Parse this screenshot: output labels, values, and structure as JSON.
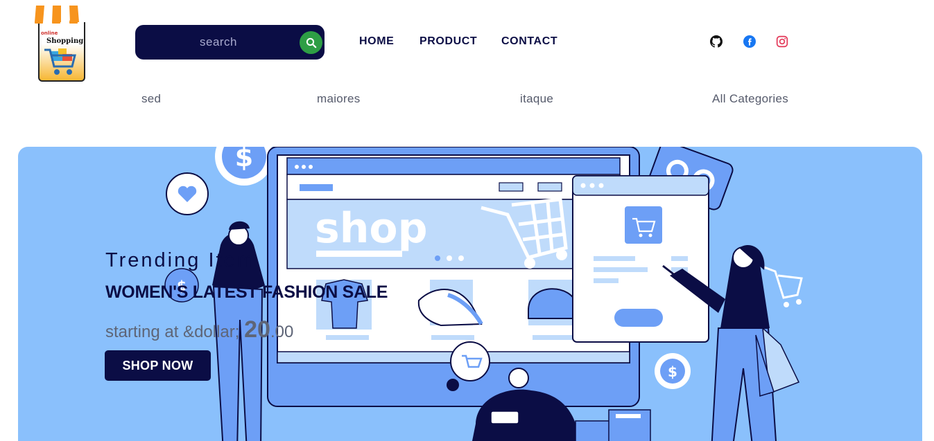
{
  "logo": {
    "line1": "online",
    "line2": "Shopping"
  },
  "search": {
    "placeholder": "search",
    "button_icon": "search-icon"
  },
  "nav": {
    "items": [
      {
        "label": "HOME"
      },
      {
        "label": "PRODUCT"
      },
      {
        "label": "CONTACT"
      }
    ]
  },
  "social": {
    "icons": [
      "github-icon",
      "facebook-icon",
      "instagram-icon"
    ],
    "colors": {
      "github": "#111111",
      "facebook": "#1877f2",
      "instagram": "#e4405f"
    }
  },
  "categories": [
    {
      "label": "sed"
    },
    {
      "label": "maiores"
    },
    {
      "label": "itaque"
    },
    {
      "label": "All Categories"
    }
  ],
  "banner": {
    "trending": "Trending Item",
    "headline": "WOMEN'S LATEST FASHION SALE",
    "price_prefix": "starting at &dollar; ",
    "price_whole": "20",
    "price_cents": ".00",
    "cta": "SHOP NOW",
    "illustration_text": "shop"
  },
  "colors": {
    "navy": "#0b0d45",
    "banner_bg": "#8ac0fc",
    "search_button": "#2e9e45"
  }
}
